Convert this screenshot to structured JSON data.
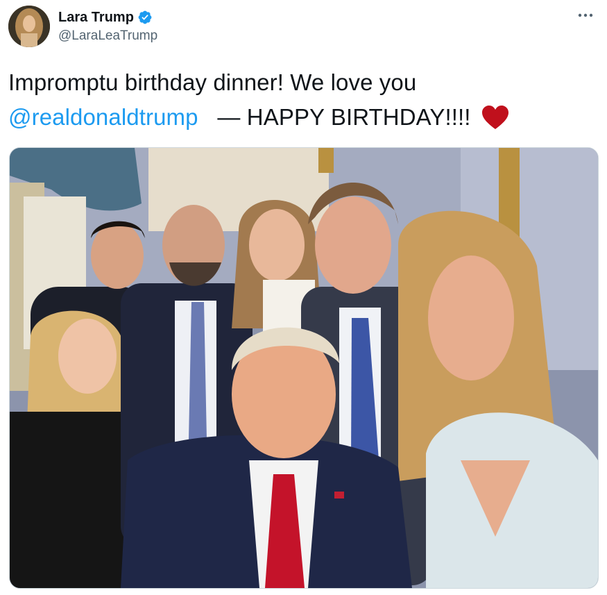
{
  "author": {
    "display_name": "Lara Trump",
    "handle": "@LaraLeaTrump",
    "verified": true,
    "avatar_icon": "profile-photo"
  },
  "tweet": {
    "text_line1": "Impromptu birthday dinner! We love you",
    "mention": "@realdonaldtrump",
    "text_line2": "— HAPPY BIRTHDAY!!!!",
    "emoji": "heart"
  },
  "media": {
    "alt": "Group selfie photo of family members smiling at a birthday dinner"
  },
  "colors": {
    "link": "#1d9bf0",
    "verified_badge": "#1d9bf0",
    "heart": "#c0101c",
    "secondary_text": "#536471"
  }
}
